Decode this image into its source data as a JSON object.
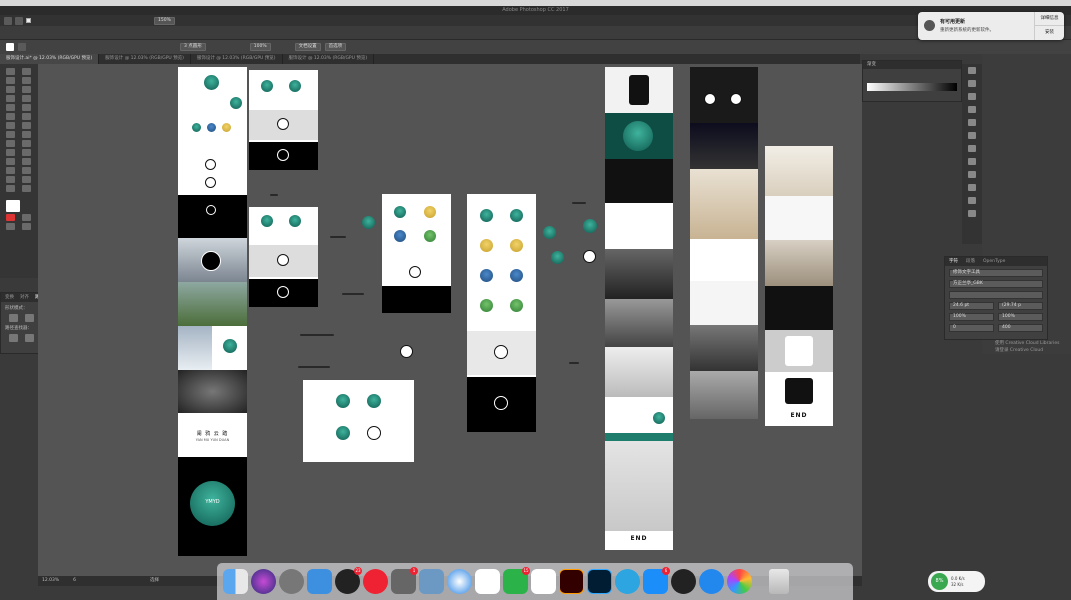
{
  "window": {
    "title": "Adobe Photoshop CC 2017"
  },
  "toolbar": {
    "zoom": "150%",
    "preset": "3 点圆形",
    "opacity": "100%",
    "doc_setup": "文档设置",
    "prefs": "首选项"
  },
  "doc_tabs": [
    {
      "label": "服饰设计.ai* @ 12.03% (RGB/GPU 预览)"
    },
    {
      "label": "服饰设计 @ 12.03% (RGB/GPU 预览)"
    },
    {
      "label": "服饰设计 @ 12.03% (RGB/GPU 预览)"
    },
    {
      "label": "服饰设计 @ 12.03% (RGB/GPU 预览)"
    }
  ],
  "pathfinder": {
    "tabs": [
      "变换",
      "对齐",
      "路径查找器"
    ],
    "shape_modes": "形状模式：",
    "pathfinders": "路径查找器："
  },
  "gradient_panel": {
    "title": "渐变"
  },
  "character_panel": {
    "tabs": [
      "字符",
      "段落",
      "OpenType"
    ],
    "search_label": "修饰文字工具",
    "font": "方正兰亭_GBK",
    "size": "24.6 pt",
    "leading": "(29.74 p",
    "scale_v": "100%",
    "scale_h": "100%",
    "tracking": "0",
    "kerning": "400"
  },
  "libraries_note": [
    "使用 Creative Cloud Libraries",
    "请登录 Creative Cloud"
  ],
  "notification": {
    "title": "有可用更新",
    "body": "重新更新系统的更新软件。",
    "details_btn": "详细信息",
    "install_btn": "安装"
  },
  "artboards": {
    "card_brand": "YMYD",
    "logo_text": "阑 鸦 云 踏",
    "logo_sub": "YAN MU YUN DUAN",
    "end_labels": [
      "END",
      "END"
    ]
  },
  "status_bar": {
    "zoom": "12.03%",
    "page": "6",
    "mode": "选择"
  },
  "dock": {
    "badges": [
      "23",
      "1",
      "15",
      "6"
    ],
    "apps": [
      "finder-icon",
      "siri-icon",
      "launchpad-icon",
      "cloud-icon",
      "qq-icon",
      "netease-icon",
      "prefs-icon",
      "photos-icon",
      "safari-icon",
      "baidu-icon",
      "wechat-icon",
      "music-icon",
      "illustrator-icon",
      "photoshop-icon",
      "telegram-icon",
      "appstore-icon",
      "qq2-icon",
      "kugou-icon",
      "photos2-icon"
    ]
  },
  "network": {
    "percent": "8%",
    "up": "0.0 K/s",
    "down": "32 K/s"
  },
  "colors": {
    "teal": "#1f7d6e",
    "gold": "#d9b641",
    "blue": "#3568a3",
    "green": "#4e9e45"
  }
}
